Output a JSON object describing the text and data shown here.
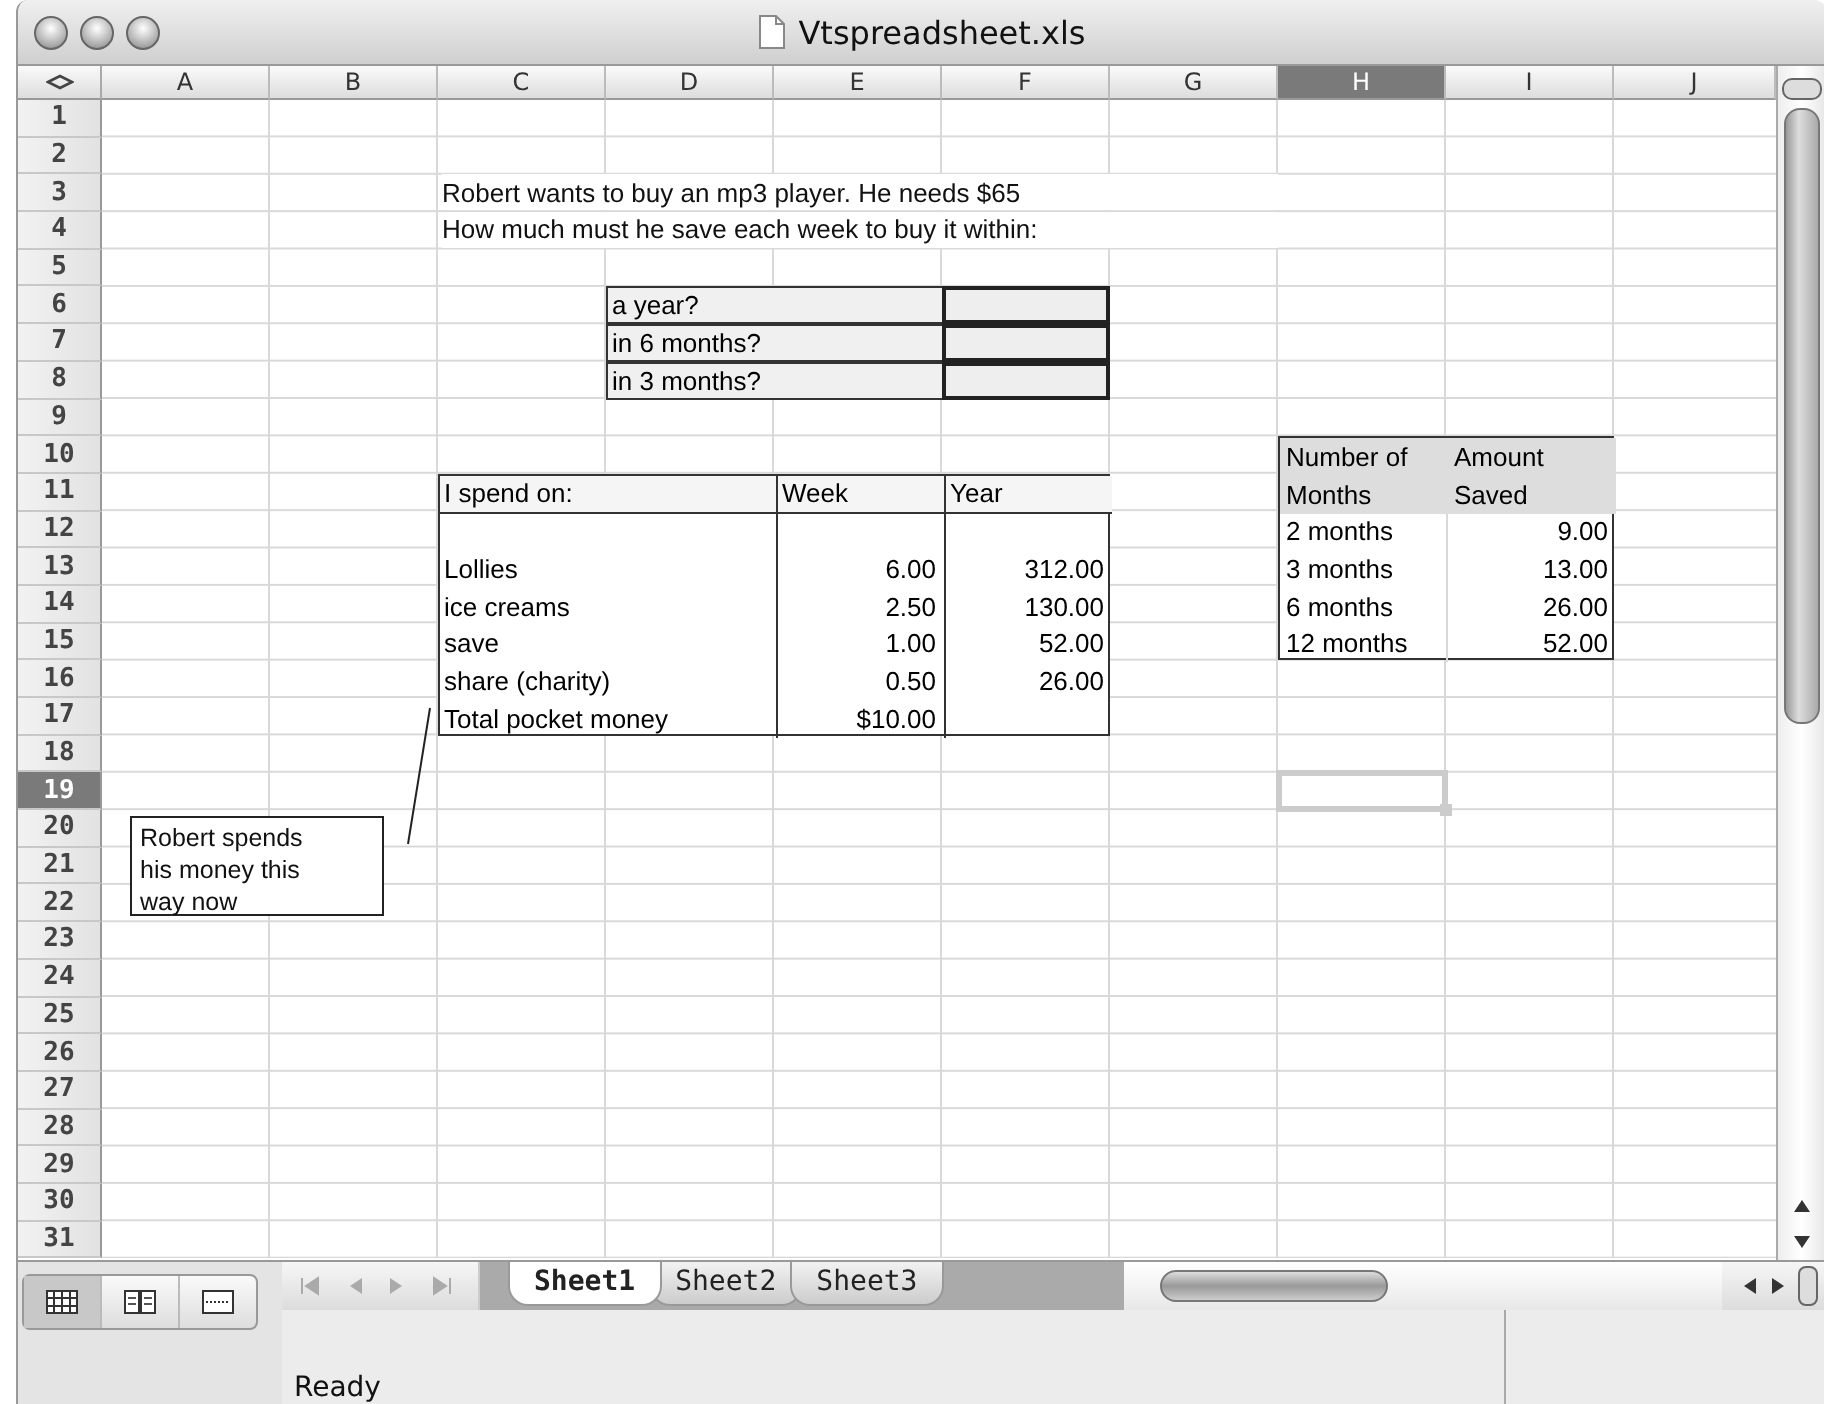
{
  "window": {
    "title": "Vtspreadsheet.xls"
  },
  "columns": [
    {
      "label": "A",
      "selected": false
    },
    {
      "label": "B",
      "selected": false
    },
    {
      "label": "C",
      "selected": false
    },
    {
      "label": "D",
      "selected": false
    },
    {
      "label": "E",
      "selected": false
    },
    {
      "label": "F",
      "selected": false
    },
    {
      "label": "G",
      "selected": false
    },
    {
      "label": "H",
      "selected": true
    },
    {
      "label": "I",
      "selected": false
    },
    {
      "label": "J",
      "selected": false
    }
  ],
  "rows": [
    {
      "label": "1",
      "selected": false
    },
    {
      "label": "2",
      "selected": false
    },
    {
      "label": "3",
      "selected": false
    },
    {
      "label": "4",
      "selected": false
    },
    {
      "label": "5",
      "selected": false
    },
    {
      "label": "6",
      "selected": false
    },
    {
      "label": "7",
      "selected": false
    },
    {
      "label": "8",
      "selected": false
    },
    {
      "label": "9",
      "selected": false
    },
    {
      "label": "10",
      "selected": false
    },
    {
      "label": "11",
      "selected": false
    },
    {
      "label": "12",
      "selected": false
    },
    {
      "label": "13",
      "selected": false
    },
    {
      "label": "14",
      "selected": false
    },
    {
      "label": "15",
      "selected": false
    },
    {
      "label": "16",
      "selected": false
    },
    {
      "label": "17",
      "selected": false
    },
    {
      "label": "18",
      "selected": false
    },
    {
      "label": "19",
      "selected": true
    },
    {
      "label": "20",
      "selected": false
    },
    {
      "label": "21",
      "selected": false
    },
    {
      "label": "22",
      "selected": false
    },
    {
      "label": "23",
      "selected": false
    },
    {
      "label": "24",
      "selected": false
    },
    {
      "label": "25",
      "selected": false
    },
    {
      "label": "26",
      "selected": false
    },
    {
      "label": "27",
      "selected": false
    },
    {
      "label": "28",
      "selected": false
    },
    {
      "label": "29",
      "selected": false
    },
    {
      "label": "30",
      "selected": false
    },
    {
      "label": "31",
      "selected": false
    }
  ],
  "intro": [
    "Robert wants to buy an mp3 player. He needs $65",
    "How much must he save each week to buy it within:"
  ],
  "questions": [
    "a year?",
    "in 6 months?",
    "in 3 months?"
  ],
  "spending_table": {
    "columns": [
      "I spend on:",
      "Week",
      "Year"
    ],
    "rows": [
      {
        "item": "Lollies",
        "week": "6.00",
        "year": "312.00"
      },
      {
        "item": "ice creams",
        "week": "2.50",
        "year": "130.00"
      },
      {
        "item": "save",
        "week": "1.00",
        "year": "52.00"
      },
      {
        "item": "share (charity)",
        "week": "0.50",
        "year": "26.00"
      },
      {
        "item": "Total pocket money",
        "week": "$10.00"
      }
    ]
  },
  "savings_table": {
    "header": [
      [
        "Number of",
        "Amount"
      ],
      [
        "Months",
        "Saved"
      ]
    ],
    "rows": [
      [
        "2 months",
        "9.00"
      ],
      [
        "3 months",
        "13.00"
      ],
      [
        "6 months",
        "26.00"
      ],
      [
        "12 months",
        "52.00"
      ]
    ]
  },
  "callout": "Robert spends his money this way now",
  "sheet_tabs": [
    {
      "label": "Sheet1",
      "selected": true
    },
    {
      "label": "Sheet2",
      "selected": false
    },
    {
      "label": "Sheet3",
      "selected": false
    }
  ],
  "status_bar": {
    "text": "Ready"
  }
}
